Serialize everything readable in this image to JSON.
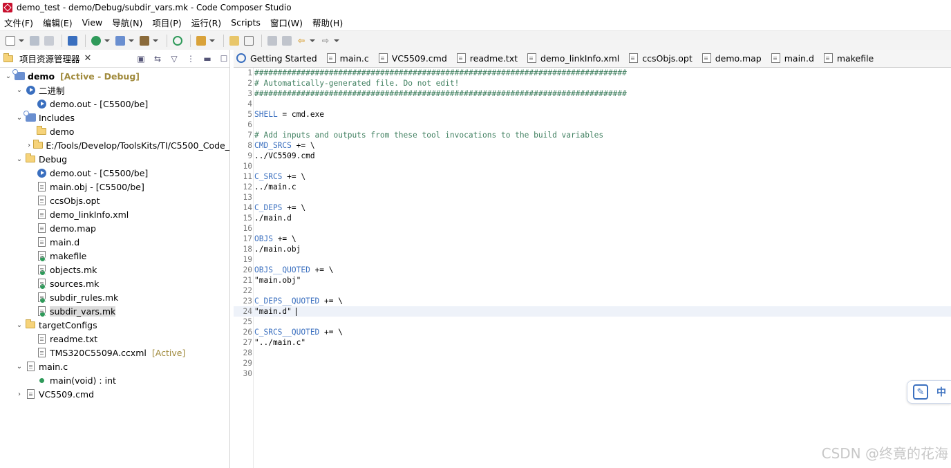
{
  "window": {
    "title": "demo_test - demo/Debug/subdir_vars.mk - Code Composer Studio"
  },
  "menu": [
    "文件(F)",
    "编辑(E)",
    "View",
    "导航(N)",
    "项目(P)",
    "运行(R)",
    "Scripts",
    "窗口(W)",
    "帮助(H)"
  ],
  "explorer": {
    "title": "项目资源管理器",
    "rows": [
      {
        "depth": 0,
        "twisty": "open",
        "icon": "project-icon",
        "label": "demo",
        "bold": true,
        "decor": "[Active - Debug]"
      },
      {
        "depth": 1,
        "twisty": "open",
        "icon": "binaries-icon",
        "label": "二进制"
      },
      {
        "depth": 2,
        "twisty": "",
        "icon": "executable-icon",
        "label": "demo.out - [C5500/be]"
      },
      {
        "depth": 1,
        "twisty": "open",
        "icon": "includes-icon",
        "label": "Includes"
      },
      {
        "depth": 2,
        "twisty": "",
        "icon": "include-folder-icon",
        "label": "demo"
      },
      {
        "depth": 2,
        "twisty": "closed",
        "icon": "include-folder-icon",
        "label": "E:/Tools/Develop/ToolsKits/TI/C5500_Code_"
      },
      {
        "depth": 1,
        "twisty": "open",
        "icon": "folder-icon",
        "label": "Debug"
      },
      {
        "depth": 2,
        "twisty": "",
        "icon": "executable-icon",
        "label": "demo.out - [C5500/be]"
      },
      {
        "depth": 2,
        "twisty": "",
        "icon": "object-file-icon",
        "label": "main.obj - [C5500/be]"
      },
      {
        "depth": 2,
        "twisty": "",
        "icon": "file-icon",
        "label": "ccsObjs.opt"
      },
      {
        "depth": 2,
        "twisty": "",
        "icon": "file-icon",
        "label": "demo_linkInfo.xml"
      },
      {
        "depth": 2,
        "twisty": "",
        "icon": "file-icon",
        "label": "demo.map"
      },
      {
        "depth": 2,
        "twisty": "",
        "icon": "file-icon",
        "label": "main.d"
      },
      {
        "depth": 2,
        "twisty": "",
        "icon": "makefile-icon",
        "label": "makefile"
      },
      {
        "depth": 2,
        "twisty": "",
        "icon": "makefile-icon",
        "label": "objects.mk"
      },
      {
        "depth": 2,
        "twisty": "",
        "icon": "makefile-icon",
        "label": "sources.mk"
      },
      {
        "depth": 2,
        "twisty": "",
        "icon": "makefile-icon",
        "label": "subdir_rules.mk"
      },
      {
        "depth": 2,
        "twisty": "",
        "icon": "makefile-icon",
        "label": "subdir_vars.mk",
        "selected": true
      },
      {
        "depth": 1,
        "twisty": "open",
        "icon": "folder-icon",
        "label": "targetConfigs"
      },
      {
        "depth": 2,
        "twisty": "",
        "icon": "file-icon",
        "label": "readme.txt"
      },
      {
        "depth": 2,
        "twisty": "",
        "icon": "ccxml-icon",
        "label": "TMS320C5509A.ccxml",
        "decor": "[Active]"
      },
      {
        "depth": 1,
        "twisty": "open",
        "icon": "c-file-icon",
        "label": "main.c"
      },
      {
        "depth": 2,
        "twisty": "",
        "icon": "function-icon",
        "label": "main(void) : int"
      },
      {
        "depth": 1,
        "twisty": "closed",
        "icon": "cmd-file-icon",
        "label": "VC5509.cmd"
      }
    ]
  },
  "editor": {
    "tabs": [
      "Getting Started",
      "main.c",
      "VC5509.cmd",
      "readme.txt",
      "demo_linkInfo.xml",
      "ccsObjs.opt",
      "demo.map",
      "main.d",
      "makefile"
    ],
    "current_line": 24,
    "lines": [
      {
        "n": "1",
        "parts": [
          {
            "t": "c",
            "s": "################################################################################"
          }
        ]
      },
      {
        "n": "2",
        "parts": [
          {
            "t": "c",
            "s": "# Automatically-generated file. Do not edit!"
          }
        ]
      },
      {
        "n": "3",
        "parts": [
          {
            "t": "c",
            "s": "################################################################################"
          }
        ]
      },
      {
        "n": "4",
        "parts": []
      },
      {
        "n": "5",
        "parts": [
          {
            "t": "v",
            "s": "SHELL"
          },
          {
            "t": "x",
            "s": " = cmd.exe"
          }
        ]
      },
      {
        "n": "6",
        "parts": []
      },
      {
        "n": "7",
        "parts": [
          {
            "t": "c",
            "s": "# Add inputs and outputs from these tool invocations to the build variables"
          }
        ]
      },
      {
        "n": "8",
        "parts": [
          {
            "t": "v",
            "s": "CMD_SRCS"
          },
          {
            "t": "x",
            "s": " += \\"
          }
        ]
      },
      {
        "n": "9",
        "parts": [
          {
            "t": "x",
            "s": "../VC5509.cmd"
          }
        ]
      },
      {
        "n": "10",
        "parts": []
      },
      {
        "n": "11",
        "parts": [
          {
            "t": "v",
            "s": "C_SRCS"
          },
          {
            "t": "x",
            "s": " += \\"
          }
        ]
      },
      {
        "n": "12",
        "parts": [
          {
            "t": "x",
            "s": "../main.c"
          }
        ]
      },
      {
        "n": "13",
        "parts": []
      },
      {
        "n": "14",
        "parts": [
          {
            "t": "v",
            "s": "C_DEPS"
          },
          {
            "t": "x",
            "s": " += \\"
          }
        ]
      },
      {
        "n": "15",
        "parts": [
          {
            "t": "x",
            "s": "./main.d"
          }
        ]
      },
      {
        "n": "16",
        "parts": []
      },
      {
        "n": "17",
        "parts": [
          {
            "t": "v",
            "s": "OBJS"
          },
          {
            "t": "x",
            "s": " += \\"
          }
        ]
      },
      {
        "n": "18",
        "parts": [
          {
            "t": "x",
            "s": "./main.obj"
          }
        ]
      },
      {
        "n": "19",
        "parts": []
      },
      {
        "n": "20",
        "parts": [
          {
            "t": "v",
            "s": "OBJS__QUOTED"
          },
          {
            "t": "x",
            "s": " += \\"
          }
        ]
      },
      {
        "n": "21",
        "parts": [
          {
            "t": "x",
            "s": "\"main.obj\""
          }
        ]
      },
      {
        "n": "22",
        "parts": []
      },
      {
        "n": "23",
        "parts": [
          {
            "t": "v",
            "s": "C_DEPS__QUOTED"
          },
          {
            "t": "x",
            "s": " += \\"
          }
        ]
      },
      {
        "n": "24",
        "parts": [
          {
            "t": "x",
            "s": "\"main.d\""
          }
        ]
      },
      {
        "n": "25",
        "parts": []
      },
      {
        "n": "26",
        "parts": [
          {
            "t": "v",
            "s": "C_SRCS__QUOTED"
          },
          {
            "t": "x",
            "s": " += \\"
          }
        ]
      },
      {
        "n": "27",
        "parts": [
          {
            "t": "x",
            "s": "\"../main.c\""
          }
        ]
      },
      {
        "n": "28",
        "parts": []
      },
      {
        "n": "29",
        "parts": []
      },
      {
        "n": "30",
        "parts": []
      }
    ]
  },
  "ime": {
    "lang": "中"
  },
  "watermark": "CSDN @终竟的花海",
  "colors": {
    "comment": "#3f7f5f",
    "variable": "#3a6fbf",
    "decoration": "#a08a3c"
  }
}
